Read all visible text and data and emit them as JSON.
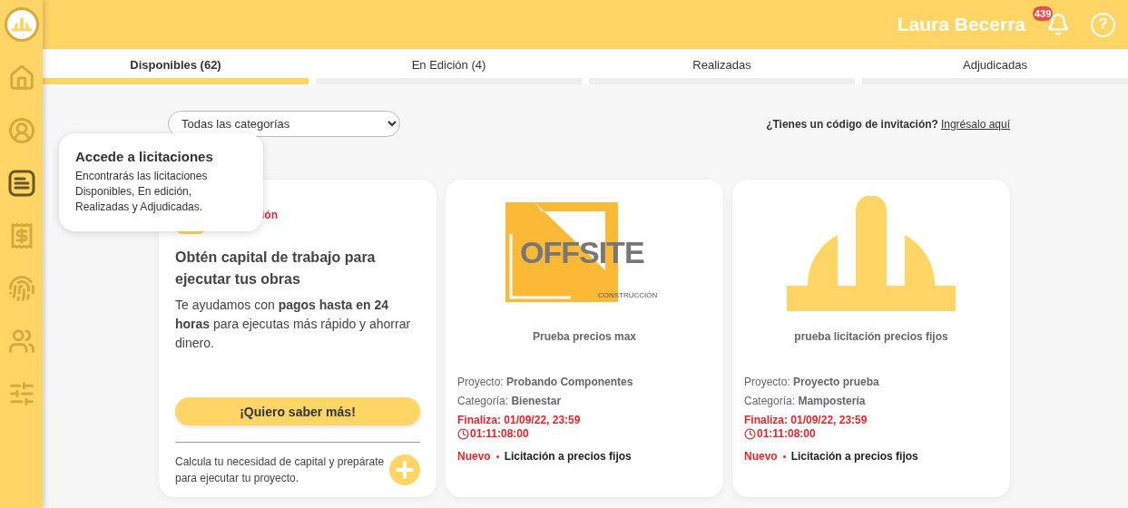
{
  "sidebar": {
    "items": [
      {
        "kind": "home",
        "selected": false
      },
      {
        "kind": "user",
        "selected": false
      },
      {
        "kind": "list",
        "selected": true
      },
      {
        "kind": "budget",
        "selected": false
      },
      {
        "kind": "fingerprint",
        "selected": false
      },
      {
        "kind": "group",
        "selected": false
      },
      {
        "kind": "settings",
        "selected": false
      }
    ]
  },
  "header": {
    "user": "Laura Becerra",
    "notifications": "439",
    "help": "?"
  },
  "tabs": [
    {
      "label": "Disponibles (62)",
      "selected": true
    },
    {
      "label": "En Edición (4)",
      "selected": false
    },
    {
      "label": "Realizadas",
      "selected": false
    },
    {
      "label": "Adjudicadas",
      "selected": false
    }
  ],
  "filter": {
    "value": "Todas las categorías"
  },
  "invitation": {
    "question": "¿Tienes un código de invitación?",
    "link": "Ingrésalo aquí"
  },
  "tooltip": {
    "title": "Accede a licitaciones",
    "body": "Encontrarás las licitaciones Disponibles, En edición, Realizadas y Adjudicadas."
  },
  "promo": {
    "tag": "ión",
    "title": "Obtén capital de trabajo para ejecutar tus obras",
    "body": "Te ayudamos con **pagos hasta en 24 horas** para ejecutas más rápido y ahorrar dinero.",
    "button": "¡Quiero saber más!",
    "footer": "Calcula tu necesidad de capital y prepárate para ejecutar tu proyecto."
  },
  "cards": [
    {
      "logo": {
        "kind": "offsite",
        "name": "OFFSITE",
        "subtitle": "CONSTRUCCIÓN"
      },
      "title": "Prueba precios max",
      "project_label": "Proyecto:",
      "project": "Probando Componentes",
      "category_label": "Categoría:",
      "category": "Bienestar",
      "deadline": "Finaliza: 01/09/22, 23:59",
      "countdown": "01:11:08:00",
      "status": "Nuevo",
      "type": "Licitación a precios fijos"
    },
    {
      "logo": {
        "kind": "helmet"
      },
      "title": "prueba licitación precios fijos",
      "project_label": "Proyecto:",
      "project": "Proyecto prueba",
      "category_label": "Categoría:",
      "category": "Mampostería",
      "deadline": "Finaliza: 01/09/22, 23:59",
      "countdown": "01:11:08:00",
      "status": "Nuevo",
      "type": "Licitación a precios fijos"
    }
  ]
}
